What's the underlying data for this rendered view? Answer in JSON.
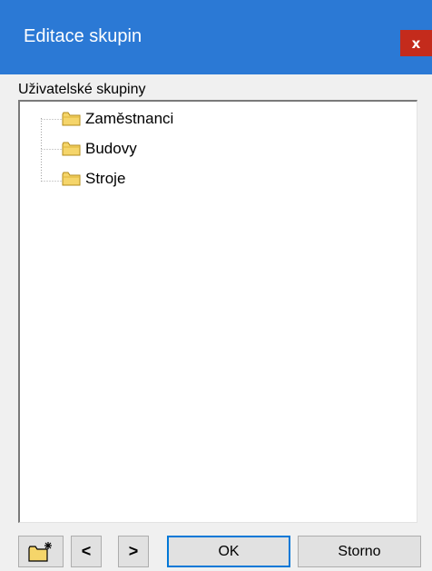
{
  "window": {
    "title": "Editace skupin",
    "close_label": "x"
  },
  "group": {
    "label": "Uživatelské skupiny",
    "items": [
      {
        "label": "Zaměstnanci",
        "icon": "folder-icon"
      },
      {
        "label": "Budovy",
        "icon": "folder-icon"
      },
      {
        "label": "Stroje",
        "icon": "folder-icon"
      }
    ]
  },
  "toolbar": {
    "new_icon": "new-folder-icon",
    "prev_label": "<",
    "next_label": ">",
    "ok_label": "OK",
    "cancel_label": "Storno"
  },
  "colors": {
    "titlebar": "#2b79d5",
    "close": "#c42b1c",
    "folder_fill": "#f5d56a",
    "folder_outline": "#b38b1a",
    "default_button_border": "#0078d7"
  }
}
